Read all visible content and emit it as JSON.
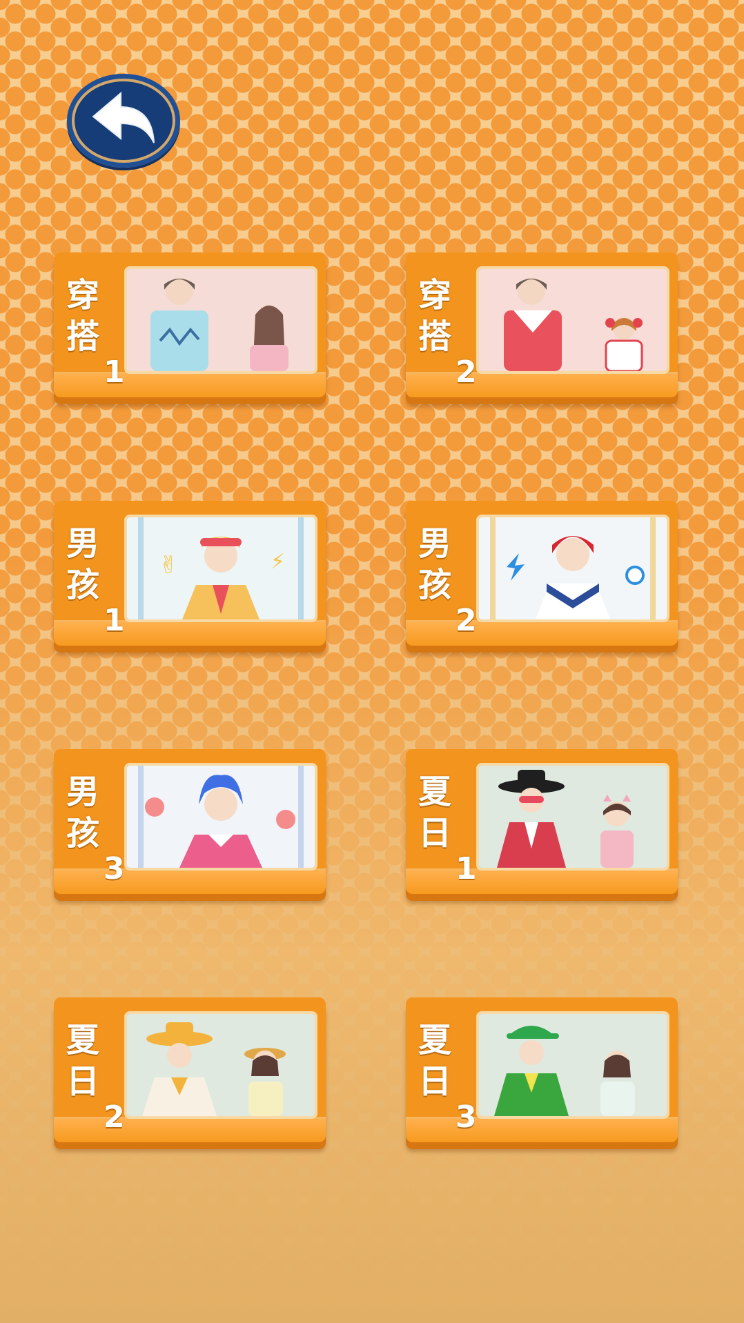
{
  "back_button": {
    "icon": "back-arrow-icon"
  },
  "cards": [
    {
      "chars": [
        "穿",
        "搭"
      ],
      "num": "1",
      "thumb": "couple-casual-1"
    },
    {
      "chars": [
        "穿",
        "搭"
      ],
      "num": "2",
      "thumb": "couple-casual-2"
    },
    {
      "chars": [
        "男",
        "孩"
      ],
      "num": "1",
      "thumb": "boy-cap-1"
    },
    {
      "chars": [
        "男",
        "孩"
      ],
      "num": "2",
      "thumb": "boy-red-hair-2"
    },
    {
      "chars": [
        "男",
        "孩"
      ],
      "num": "3",
      "thumb": "boy-blue-hair-3"
    },
    {
      "chars": [
        "夏",
        "日"
      ],
      "num": "1",
      "thumb": "summer-couple-1"
    },
    {
      "chars": [
        "夏",
        "日"
      ],
      "num": "2",
      "thumb": "summer-couple-2"
    },
    {
      "chars": [
        "夏",
        "日"
      ],
      "num": "3",
      "thumb": "summer-couple-3"
    }
  ]
}
